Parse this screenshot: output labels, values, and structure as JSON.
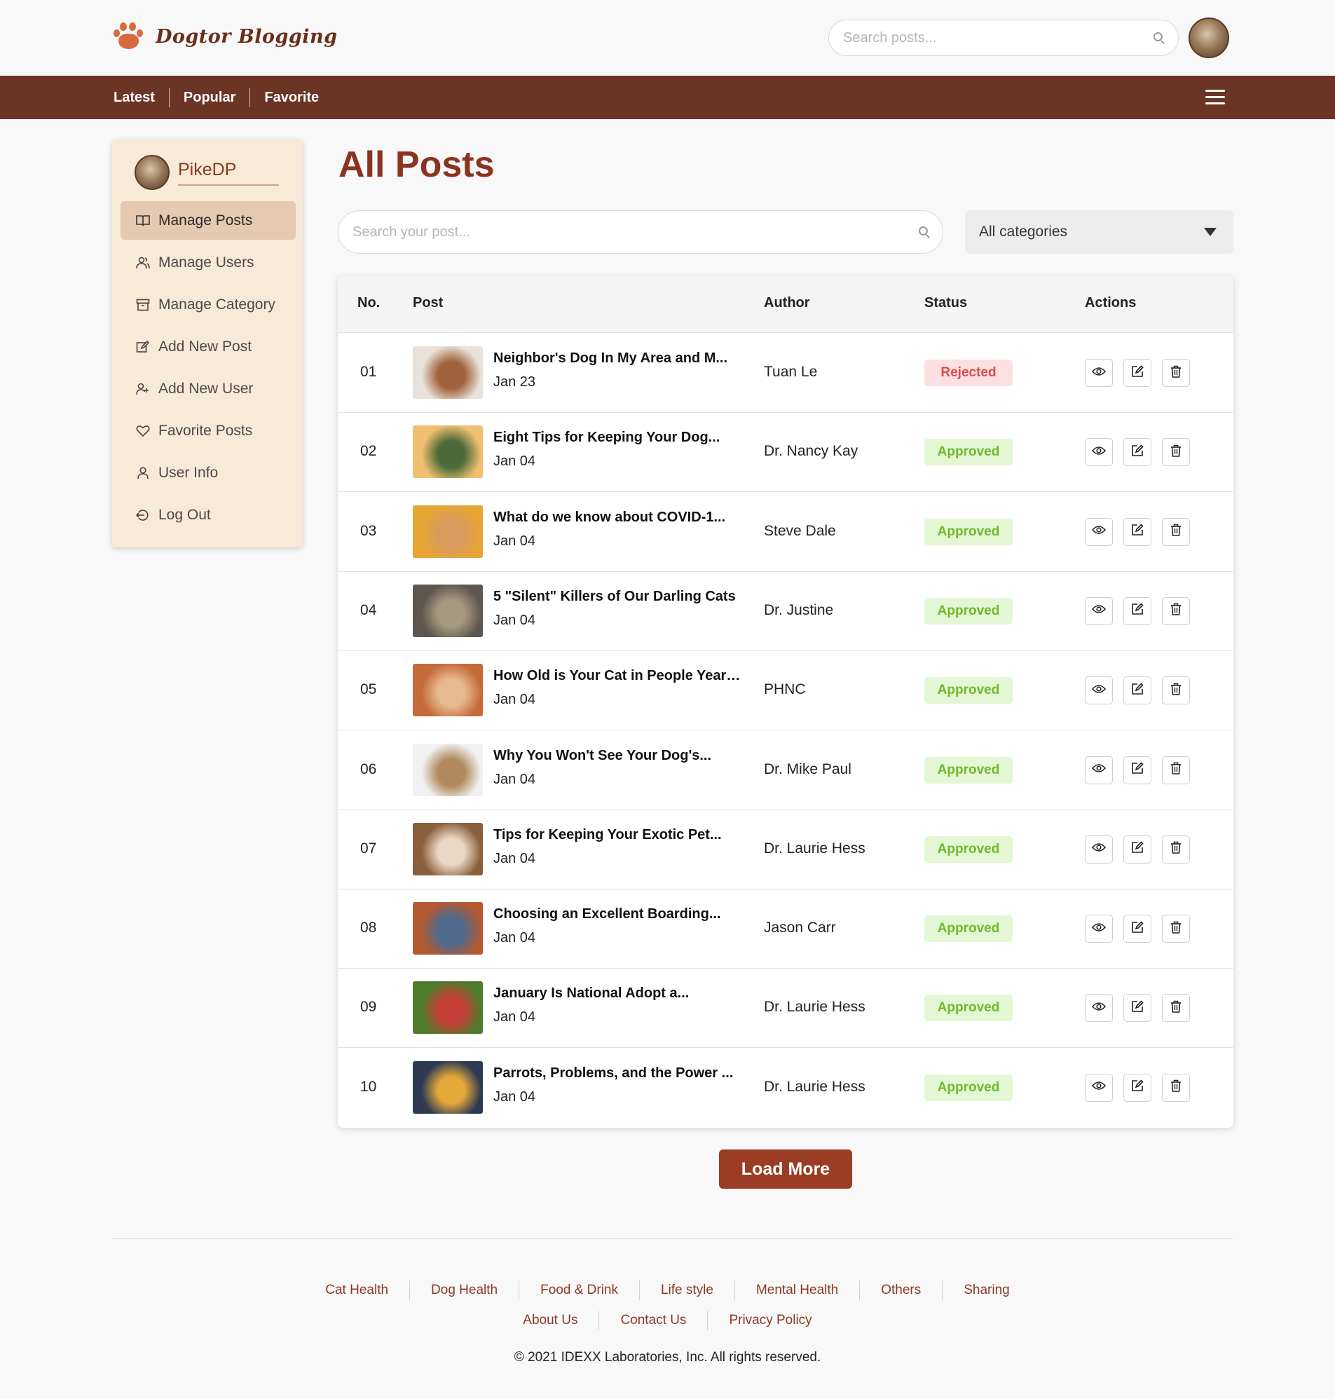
{
  "header": {
    "logo_text": "Dogtor Blogging",
    "search_placeholder": "Search posts..."
  },
  "nav": {
    "links": [
      "Latest",
      "Popular",
      "Favorite"
    ]
  },
  "sidebar": {
    "username": "PikeDP",
    "items": [
      {
        "label": "Manage Posts",
        "icon": "book-icon",
        "active": true
      },
      {
        "label": "Manage Users",
        "icon": "users-icon",
        "active": false
      },
      {
        "label": "Manage Category",
        "icon": "archive-icon",
        "active": false
      },
      {
        "label": "Add New Post",
        "icon": "edit-icon",
        "active": false
      },
      {
        "label": "Add New User",
        "icon": "user-plus-icon",
        "active": false
      },
      {
        "label": "Favorite Posts",
        "icon": "heart-icon",
        "active": false
      },
      {
        "label": "User Info",
        "icon": "user-icon",
        "active": false
      },
      {
        "label": "Log Out",
        "icon": "logout-icon",
        "active": false
      }
    ]
  },
  "main": {
    "title": "All Posts",
    "search_placeholder": "Search your post...",
    "category_selected": "All categories",
    "columns": [
      "No.",
      "Post",
      "Author",
      "Status",
      "Actions"
    ],
    "rows": [
      {
        "no": "01",
        "title": "Neighbor's Dog In My Area and M...",
        "date": "Jan 23",
        "author": "Tuan Le",
        "status": "Rejected"
      },
      {
        "no": "02",
        "title": "Eight Tips for Keeping Your Dog...",
        "date": "Jan 04",
        "author": "Dr. Nancy Kay",
        "status": "Approved"
      },
      {
        "no": "03",
        "title": "What do we know about COVID-1...",
        "date": "Jan 04",
        "author": "Steve Dale",
        "status": "Approved"
      },
      {
        "no": "04",
        "title": "5 \"Silent\" Killers of Our Darling Cats",
        "date": "Jan 04",
        "author": "Dr. Justine",
        "status": "Approved"
      },
      {
        "no": "05",
        "title": "How Old is Your Cat in People Years?",
        "date": "Jan 04",
        "author": "PHNC",
        "status": "Approved"
      },
      {
        "no": "06",
        "title": "Why You Won't See Your Dog's...",
        "date": "Jan 04",
        "author": "Dr. Mike Paul",
        "status": "Approved"
      },
      {
        "no": "07",
        "title": "Tips for Keeping Your Exotic Pet...",
        "date": "Jan 04",
        "author": "Dr. Laurie Hess",
        "status": "Approved"
      },
      {
        "no": "08",
        "title": "Choosing an Excellent Boarding...",
        "date": "Jan 04",
        "author": "Jason Carr",
        "status": "Approved"
      },
      {
        "no": "09",
        "title": "January Is National Adopt a...",
        "date": "Jan 04",
        "author": "Dr. Laurie Hess",
        "status": "Approved"
      },
      {
        "no": "10",
        "title": "Parrots, Problems, and the Power ...",
        "date": "Jan 04",
        "author": "Dr. Laurie Hess",
        "status": "Approved"
      }
    ],
    "load_more": "Load More"
  },
  "footer": {
    "categories": [
      "Cat Health",
      "Dog Health",
      "Food & Drink",
      "Life style",
      "Mental Health",
      "Others",
      "Sharing"
    ],
    "links": [
      "About Us",
      "Contact Us",
      "Privacy Policy"
    ],
    "copyright": "© 2021 IDEXX Laboratories, Inc. All rights reserved."
  },
  "colors": {
    "brand": "#6b3424",
    "accent": "#9a3d24",
    "approved": "#6fb92c",
    "rejected": "#e04848"
  }
}
